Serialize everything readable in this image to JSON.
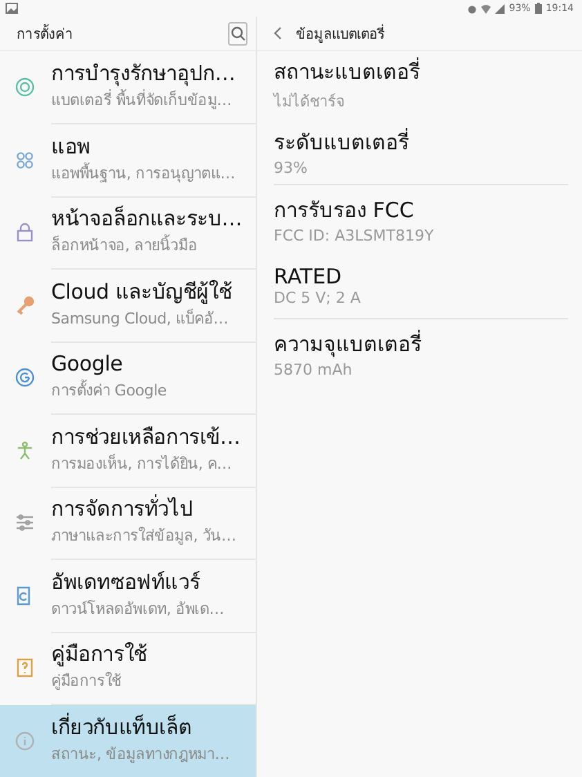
{
  "status_bar": {
    "battery": "93%",
    "time": "19:14"
  },
  "sidebar": {
    "title": "การตั้งค่า",
    "items": [
      {
        "title": "การบำรุงรักษาอุปก…",
        "subtitle": "แบตเตอรี่ พื้นที่จัดเก็บข้อมู…",
        "selected": false
      },
      {
        "title": "แอพ",
        "subtitle": "แอพพื้นฐาน, การอนุญาตแ…",
        "selected": false
      },
      {
        "title": "หน้าจอล็อกและระบ…",
        "subtitle": "ล็อกหน้าจอ, ลายนิ้วมือ",
        "selected": false
      },
      {
        "title": "Cloud และบัญชีผู้ใช้",
        "subtitle": "Samsung Cloud, แบ็คอั…",
        "selected": false
      },
      {
        "title": "Google",
        "subtitle": "การตั้งค่า Google",
        "selected": false
      },
      {
        "title": "การช่วยเหลือการเข้…",
        "subtitle": "การมองเห็น, การได้ยิน, ค…",
        "selected": false
      },
      {
        "title": "การจัดการทั่วไป",
        "subtitle": "ภาษาและการใส่ข้อมูล, วัน…",
        "selected": false
      },
      {
        "title": "อัพเดทซอฟท์แวร์",
        "subtitle": "ดาวน์โหลดอัพเดท, อัพเด…",
        "selected": false
      },
      {
        "title": "คู่มือการใช้",
        "subtitle": "คู่มือการใช้",
        "selected": false
      },
      {
        "title": "เกี่ยวกับแท็บเล็ต",
        "subtitle": "สถานะ, ข้อมูลทางกฎหมา…",
        "selected": true
      }
    ]
  },
  "detail": {
    "title": "ข้อมูลแบตเตอรี่",
    "groups": [
      [
        {
          "title": "สถานะแบตเตอรี่",
          "value": "ไม่ได้ชาร์จ"
        },
        {
          "title": "ระดับแบตเตอรี่",
          "value": "93%"
        }
      ],
      [
        {
          "title": "การรับรอง FCC",
          "value": "FCC ID: A3LSMT819Y"
        },
        {
          "title": "RATED",
          "value": "DC 5 V; 2 A"
        }
      ],
      [
        {
          "title": "ความจุแบตเตอรี่",
          "value": "5870 mAh"
        }
      ]
    ]
  }
}
